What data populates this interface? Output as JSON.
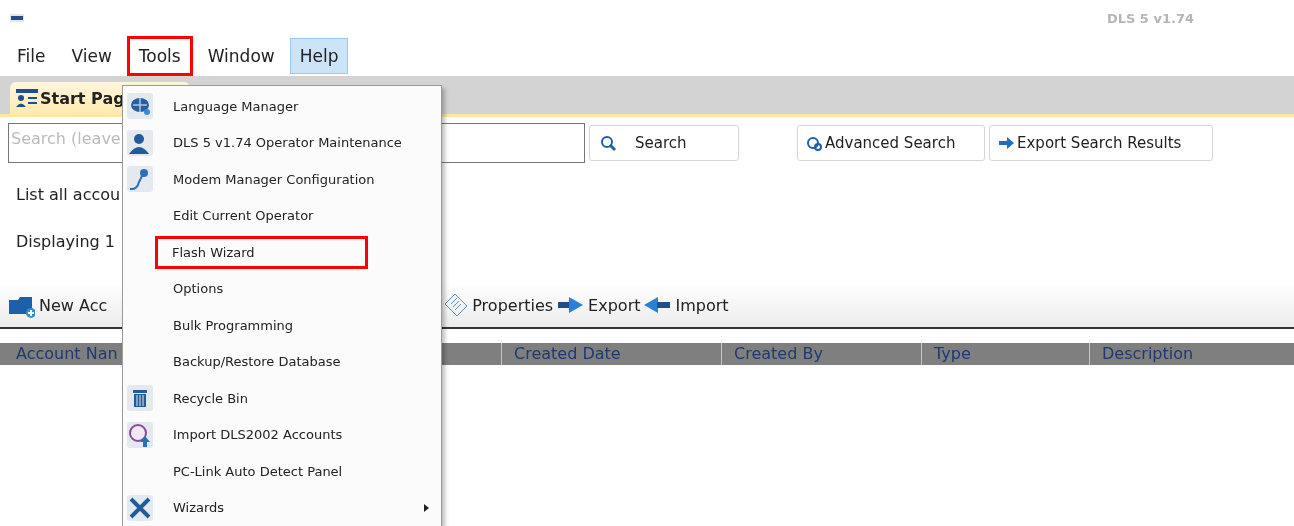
{
  "window": {
    "title": "DLS 5 v1.74"
  },
  "menu_bar": [
    {
      "label": "File",
      "selected": false,
      "annotated": false
    },
    {
      "label": "View",
      "selected": false,
      "annotated": false
    },
    {
      "label": "Tools",
      "selected": false,
      "annotated": true
    },
    {
      "label": "Window",
      "selected": false,
      "annotated": false
    },
    {
      "label": "Help",
      "selected": true,
      "annotated": false
    }
  ],
  "tabs": [
    {
      "label": "Start Pag",
      "selected": true
    }
  ],
  "search": {
    "placeholder": "Search (leave",
    "buttons": [
      "Search",
      "Advanced Search",
      "Export Search Results"
    ]
  },
  "info_lines": [
    "List all accou",
    "Displaying 1"
  ],
  "toolbar": [
    "New Acc",
    "Properties",
    "Export",
    "Import"
  ],
  "table": {
    "columns": [
      "Account Nan",
      "Created Date",
      "Created By",
      "Type",
      "Description"
    ]
  },
  "tools_menu": [
    {
      "label": "Language Manager",
      "annotated": false,
      "has_submenu": false
    },
    {
      "label": "DLS 5 v1.74 Operator Maintenance",
      "annotated": false,
      "has_submenu": false
    },
    {
      "label": "Modem Manager Configuration",
      "annotated": false,
      "has_submenu": false
    },
    {
      "label": "Edit Current Operator",
      "annotated": false,
      "has_submenu": false
    },
    {
      "label": "Flash Wizard",
      "annotated": true,
      "has_submenu": false
    },
    {
      "label": "Options",
      "annotated": false,
      "has_submenu": false
    },
    {
      "label": "Bulk Programming",
      "annotated": false,
      "has_submenu": false
    },
    {
      "label": "Backup/Restore Database",
      "annotated": false,
      "has_submenu": false
    },
    {
      "label": "Recycle Bin",
      "annotated": false,
      "has_submenu": false
    },
    {
      "label": "Import DLS2002 Accounts",
      "annotated": false,
      "has_submenu": false
    },
    {
      "label": "PC-Link Auto Detect Panel",
      "annotated": false,
      "has_submenu": false
    },
    {
      "label": "Wizards",
      "annotated": false,
      "has_submenu": true
    }
  ]
}
